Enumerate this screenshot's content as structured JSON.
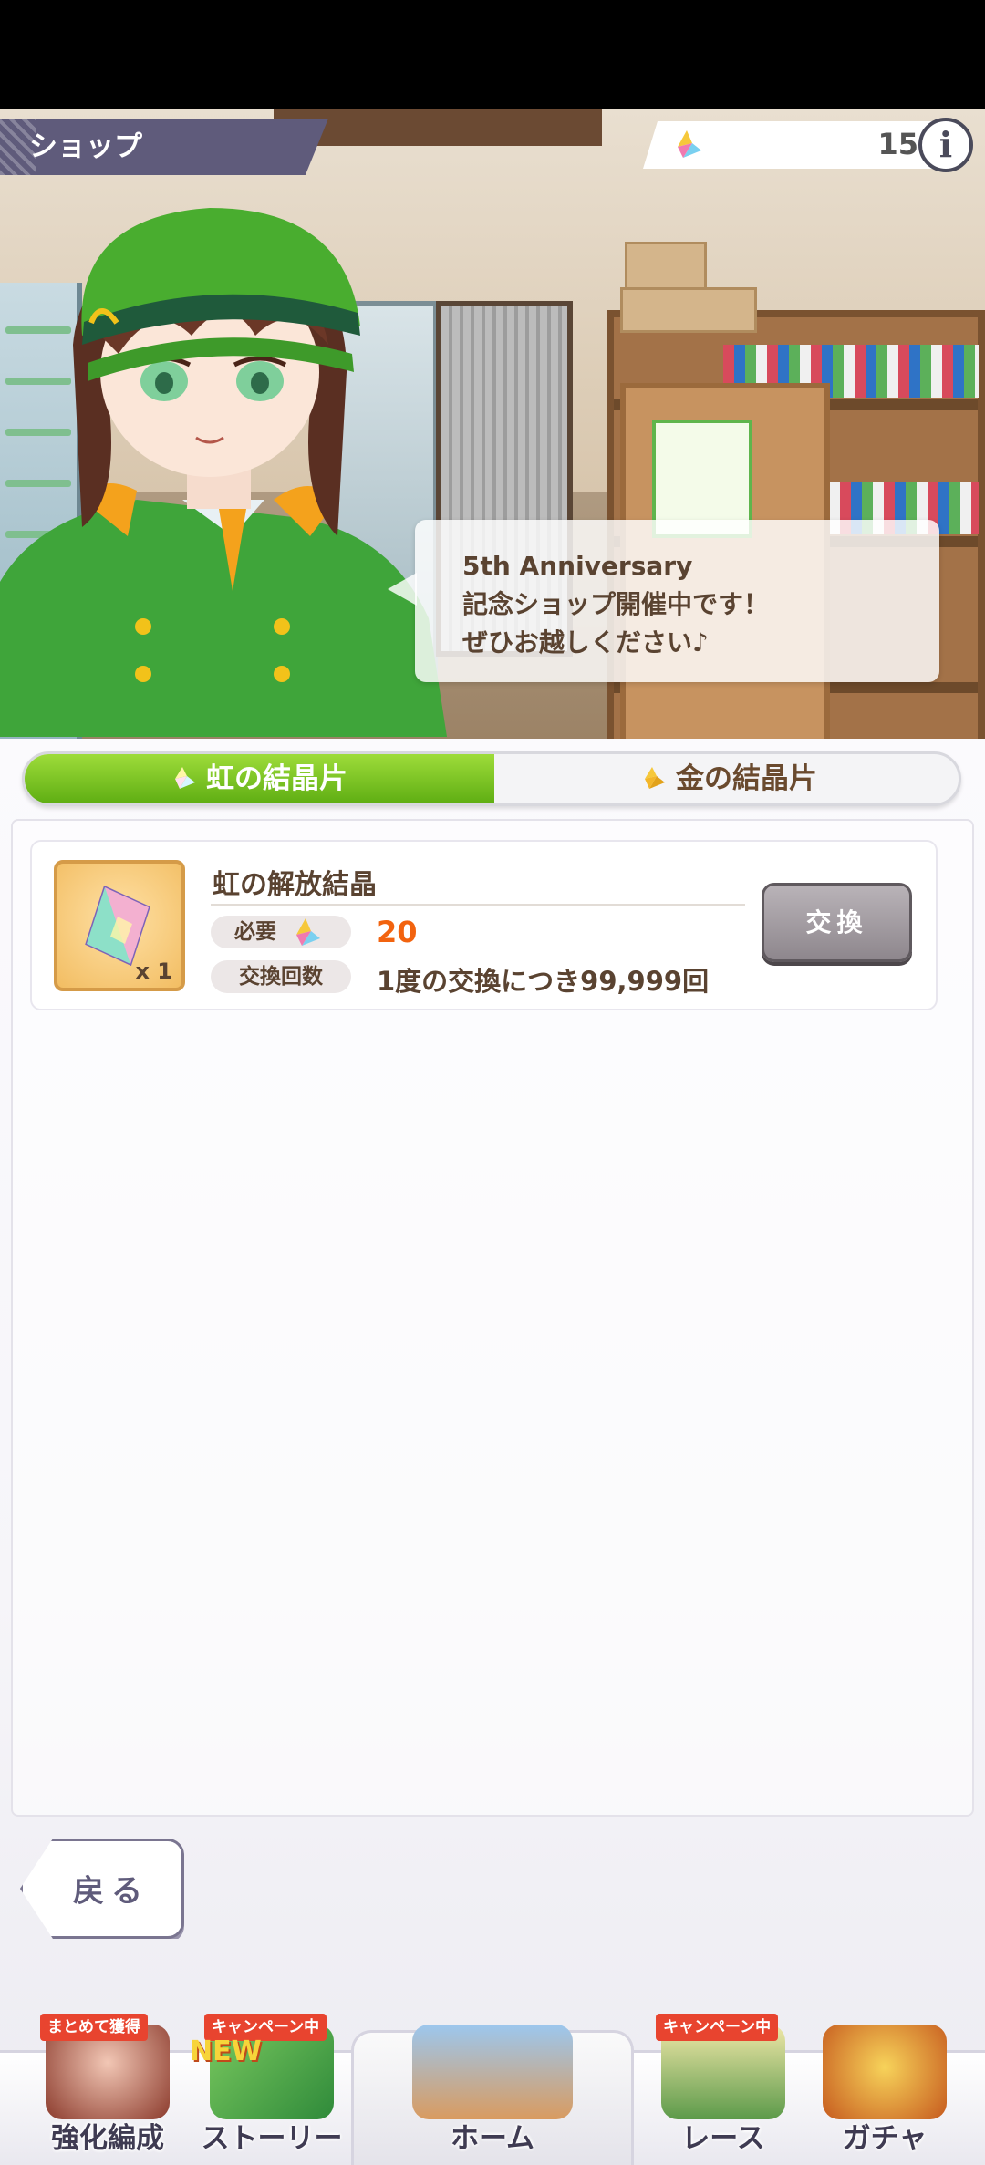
{
  "header": {
    "title": "ショップ",
    "currency_count": "15",
    "info_label": "i"
  },
  "hero": {
    "speech_line1": "5th Anniversary",
    "speech_line2": "記念ショップ開催中です！",
    "speech_line3": "ぜひお越しください♪"
  },
  "tabs": [
    {
      "label": "虹の結晶片",
      "active": true
    },
    {
      "label": "金の結晶片",
      "active": false
    }
  ],
  "items": [
    {
      "name": "虹の解放結晶",
      "quantity": "x 1",
      "need_label": "必要",
      "cost": "20",
      "limit_label": "交換回数",
      "limit_value": "1度の交換につき99,999回",
      "exchange_label": "交換"
    }
  ],
  "back_label": "戻る",
  "nav": {
    "items": [
      {
        "label": "強化編成",
        "tag": "まとめて獲得"
      },
      {
        "label": "ストーリー",
        "tag": "キャンペーン中",
        "badge": "NEW"
      },
      {
        "label": "ホーム"
      },
      {
        "label": "レース",
        "tag": "キャンペーン中"
      },
      {
        "label": "ガチャ"
      }
    ]
  },
  "colors": {
    "title_bg": "#5f5b7b",
    "tab_active": "#6ebf1c",
    "cost": "#f2630f",
    "nav_tag": "#e8442f"
  }
}
